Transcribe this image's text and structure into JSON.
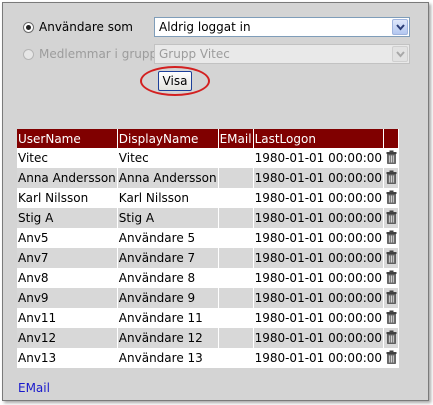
{
  "filter": {
    "option_users": {
      "label": "Användare som",
      "selected": true
    },
    "option_members": {
      "label": "Medlemmar i grupp",
      "selected": false,
      "disabled": true
    },
    "users_select": {
      "value": "Aldrig loggat in"
    },
    "group_select": {
      "value": "Grupp Vitec",
      "disabled": true
    },
    "show_button": "Visa"
  },
  "table": {
    "columns": [
      "UserName",
      "DisplayName",
      "EMail",
      "LastLogon"
    ],
    "rows": [
      {
        "username": "Vitec",
        "displayname": "Vitec",
        "email": "",
        "lastlogon": "1980-01-01 00:00:00"
      },
      {
        "username": "Anna Andersson",
        "displayname": "Anna Andersson",
        "email": "",
        "lastlogon": "1980-01-01 00:00:00"
      },
      {
        "username": "Karl Nilsson",
        "displayname": "Karl Nilsson",
        "email": "",
        "lastlogon": "1980-01-01 00:00:00"
      },
      {
        "username": "Stig A",
        "displayname": "Stig A",
        "email": "",
        "lastlogon": "1980-01-01 00:00:00"
      },
      {
        "username": "Anv5",
        "displayname": "Användare 5",
        "email": "",
        "lastlogon": "1980-01-01 00:00:00"
      },
      {
        "username": "Anv7",
        "displayname": "Användare 7",
        "email": "",
        "lastlogon": "1980-01-01 00:00:00"
      },
      {
        "username": "Anv8",
        "displayname": "Användare 8",
        "email": "",
        "lastlogon": "1980-01-01 00:00:00"
      },
      {
        "username": "Anv9",
        "displayname": "Användare 9",
        "email": "",
        "lastlogon": "1980-01-01 00:00:00"
      },
      {
        "username": "Anv11",
        "displayname": "Användare 11",
        "email": "",
        "lastlogon": "1980-01-01 00:00:00"
      },
      {
        "username": "Anv12",
        "displayname": "Användare 12",
        "email": "",
        "lastlogon": "1980-01-01 00:00:00"
      },
      {
        "username": "Anv13",
        "displayname": "Användare 13",
        "email": "",
        "lastlogon": "1980-01-01 00:00:00"
      }
    ],
    "row_action_icon": "trash-icon"
  },
  "footer": {
    "email_link": "EMail"
  },
  "colors": {
    "header_bg": "#800000",
    "row_alt_bg": "#d8d8d8",
    "highlight": "#d32020",
    "link": "#1a1acc"
  }
}
